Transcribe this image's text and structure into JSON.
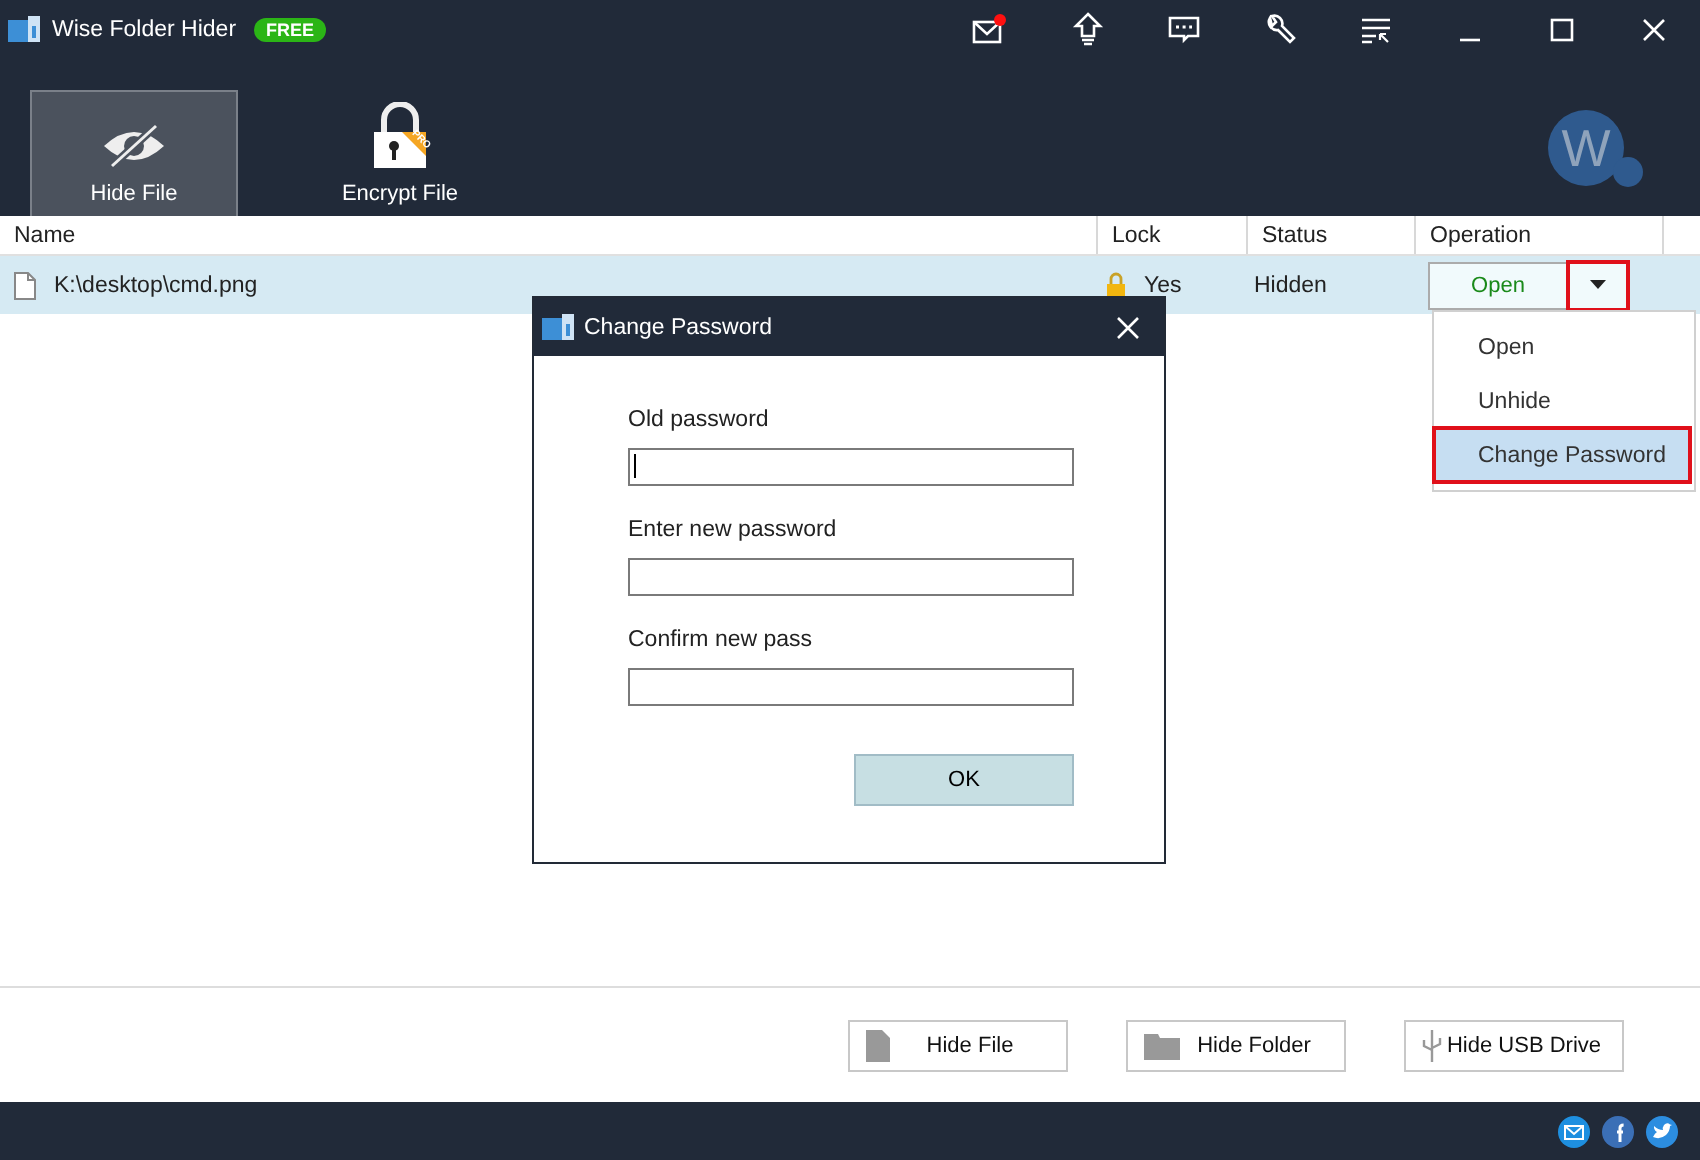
{
  "app": {
    "title": "Wise Folder Hider",
    "badge": "FREE",
    "has_new_message": true,
    "avatar": "W"
  },
  "tabs": [
    {
      "label": "Hide File",
      "kind": "hide",
      "selected": true
    },
    {
      "label": "Encrypt File",
      "kind": "encrypt",
      "selected": false,
      "badge": "PRO"
    }
  ],
  "table": {
    "columns": [
      "Name",
      "Lock",
      "Status",
      "Operation"
    ],
    "rows": [
      {
        "name": "K:\\desktop\\cmd.png",
        "locked": true,
        "lock": "Yes",
        "status": "Hidden",
        "action": "Open",
        "selected": true,
        "menu_highlighted": true
      }
    ]
  },
  "menu": {
    "items": [
      {
        "label": "Open",
        "selected": false,
        "highlighted": false
      },
      {
        "label": "Unhide",
        "selected": false,
        "highlighted": false
      },
      {
        "label": "Change Password",
        "selected": true,
        "highlighted": true
      }
    ]
  },
  "dialog": {
    "title": "Change Password",
    "fields": [
      {
        "label": "Old password",
        "focused": true
      },
      {
        "label": "Enter new password",
        "focused": false
      },
      {
        "label": "Confirm new pass",
        "focused": false
      }
    ],
    "ok": "OK"
  },
  "bottom_buttons": [
    {
      "label": "Hide File",
      "kind": "file"
    },
    {
      "label": "Hide Folder",
      "kind": "folder"
    },
    {
      "label": "Hide USB Drive",
      "kind": "usb"
    }
  ]
}
